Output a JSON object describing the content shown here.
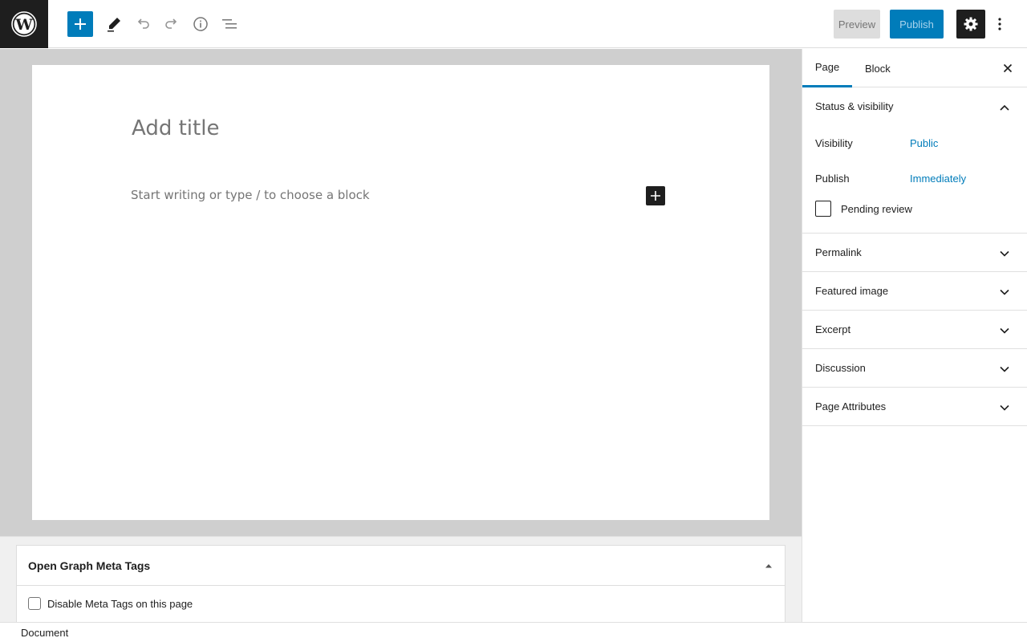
{
  "toolbar": {
    "logo_icon": "wordpress-logo",
    "add_block_icon": "plus-icon",
    "tools": [
      "pencil-icon",
      "undo-icon",
      "redo-icon",
      "info-icon",
      "list-view-icon"
    ],
    "preview_label": "Preview",
    "publish_label": "Publish",
    "settings_icon": "gear-icon",
    "more_icon": "more-vertical-icon",
    "accent_color": "#007cba"
  },
  "editor": {
    "title_placeholder": "Add title",
    "block_placeholder": "Start writing or type / to choose a block"
  },
  "sidebar": {
    "tabs": [
      {
        "label": "Page",
        "active": true
      },
      {
        "label": "Block",
        "active": false
      }
    ],
    "status_panel": {
      "title": "Status & visibility",
      "expanded": true,
      "rows": [
        {
          "label": "Visibility",
          "value": "Public"
        },
        {
          "label": "Publish",
          "value": "Immediately"
        }
      ],
      "pending_label": "Pending review",
      "pending_checked": false
    },
    "panels": [
      {
        "title": "Permalink"
      },
      {
        "title": "Featured image"
      },
      {
        "title": "Excerpt"
      },
      {
        "title": "Discussion"
      },
      {
        "title": "Page Attributes"
      }
    ]
  },
  "metabox": {
    "title": "Open Graph Meta Tags",
    "checkbox_label": "Disable Meta Tags on this page",
    "checked": false
  },
  "footer": {
    "breadcrumb": "Document"
  }
}
